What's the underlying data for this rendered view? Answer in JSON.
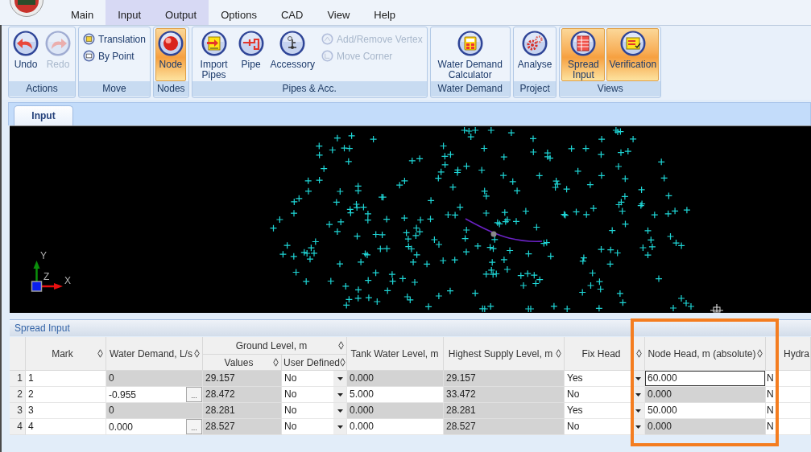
{
  "menu": {
    "tabs": [
      {
        "label": "Main",
        "contextual": false
      },
      {
        "label": "Input",
        "contextual": true
      },
      {
        "label": "Output",
        "contextual": true
      },
      {
        "label": "Options",
        "contextual": false
      },
      {
        "label": "CAD",
        "contextual": false
      },
      {
        "label": "View",
        "contextual": false
      },
      {
        "label": "Help",
        "contextual": false
      }
    ]
  },
  "ribbon": {
    "groups": [
      {
        "label": "Actions",
        "buttons": [
          {
            "kind": "large",
            "label": "Undo",
            "selected": false,
            "disabled": false
          },
          {
            "kind": "large",
            "label": "Redo",
            "selected": false,
            "disabled": true
          }
        ]
      },
      {
        "label": "Move",
        "buttons": [
          {
            "kind": "small",
            "label": "Translation",
            "selected": false,
            "disabled": false
          },
          {
            "kind": "small",
            "label": "By Point",
            "selected": false,
            "disabled": false
          }
        ]
      },
      {
        "label": "Nodes",
        "buttons": [
          {
            "kind": "large",
            "label": "Node",
            "selected": true,
            "disabled": false
          }
        ]
      },
      {
        "label": "Pipes & Acc.",
        "buttons": [
          {
            "kind": "large",
            "label": "Import Pipes",
            "selected": false,
            "disabled": false
          },
          {
            "kind": "large",
            "label": "Pipe",
            "selected": false,
            "disabled": false
          },
          {
            "kind": "large",
            "label": "Accessory",
            "selected": false,
            "disabled": false
          },
          {
            "kind": "small",
            "label": "Add/Remove Vertex",
            "selected": false,
            "disabled": true
          },
          {
            "kind": "small",
            "label": "Move Corner",
            "selected": false,
            "disabled": true
          }
        ]
      },
      {
        "label": "Water Demand",
        "buttons": [
          {
            "kind": "large",
            "label": "Water Demand Calculator",
            "selected": false,
            "disabled": false
          }
        ]
      },
      {
        "label": "Project",
        "buttons": [
          {
            "kind": "large",
            "label": "Analyse",
            "selected": false,
            "disabled": false
          }
        ]
      },
      {
        "label": "Views",
        "buttons": [
          {
            "kind": "large",
            "label": "Spread Input",
            "selected": true,
            "disabled": false
          },
          {
            "kind": "large",
            "label": "Verification",
            "selected": true,
            "disabled": false
          }
        ]
      }
    ]
  },
  "document_tabs": [
    {
      "label": "Input",
      "selected": true
    }
  ],
  "canvas": {
    "axes": {
      "x": "X",
      "y": "Y",
      "z": "Z"
    }
  },
  "spread_input": {
    "title": "Spread Input",
    "table": {
      "columns": [
        {
          "label": "Mark",
          "sortable": true,
          "highlighted": false
        },
        {
          "label": "Water Demand, L/s",
          "sortable": true,
          "highlighted": false
        },
        {
          "label": "Values",
          "sortable": true,
          "highlighted": false,
          "group": {
            "label": "Ground Level, m",
            "sortable": true,
            "highlighted": false
          }
        },
        {
          "label": "User Defined",
          "sortable": true,
          "highlighted": false,
          "joins_group": true
        },
        {
          "label": "Tank Water Level, m",
          "sortable": false,
          "highlighted": false
        },
        {
          "label": "Highest Supply Level, m",
          "sortable": true,
          "highlighted": false
        },
        {
          "label": "Fix Head",
          "sortable": true,
          "highlighted": false
        },
        {
          "label": "Node Head, m (absolute)",
          "sortable": true,
          "highlighted": true
        },
        {
          "label": "Hydra",
          "sortable": false,
          "highlighted": false
        }
      ],
      "rows": [
        {
          "number": "1",
          "cells": [
            {
              "kind": "text",
              "text": "1",
              "readonly": false,
              "selected": false
            },
            {
              "kind": "text",
              "text": "0",
              "readonly": true,
              "selected": false
            },
            {
              "kind": "text",
              "text": "29.157",
              "readonly": true,
              "selected": false
            },
            {
              "kind": "dropdown",
              "text": "No",
              "readonly": false,
              "selected": false
            },
            {
              "kind": "text",
              "text": "0.000",
              "readonly": true,
              "selected": false
            },
            {
              "kind": "text",
              "text": "29.157",
              "readonly": true,
              "selected": false
            },
            {
              "kind": "dropdown",
              "text": "Yes",
              "readonly": false,
              "selected": false
            },
            {
              "kind": "text",
              "text": "60.000",
              "readonly": false,
              "selected": true
            },
            {
              "kind": "text",
              "text": "N",
              "readonly": false,
              "selected": false
            }
          ]
        },
        {
          "number": "2",
          "cells": [
            {
              "kind": "text",
              "text": "2",
              "readonly": false,
              "selected": false
            },
            {
              "kind": "picker",
              "text": "-0.955",
              "button": "...",
              "readonly": false,
              "selected": false
            },
            {
              "kind": "text",
              "text": "28.472",
              "readonly": true,
              "selected": false
            },
            {
              "kind": "dropdown",
              "text": "No",
              "readonly": false,
              "selected": false
            },
            {
              "kind": "text",
              "text": "5.000",
              "readonly": false,
              "selected": false
            },
            {
              "kind": "text",
              "text": "33.472",
              "readonly": true,
              "selected": false
            },
            {
              "kind": "dropdown",
              "text": "No",
              "readonly": false,
              "selected": false
            },
            {
              "kind": "text",
              "text": "0.000",
              "readonly": true,
              "selected": false
            },
            {
              "kind": "text",
              "text": "N",
              "readonly": false,
              "selected": false
            }
          ]
        },
        {
          "number": "3",
          "cells": [
            {
              "kind": "text",
              "text": "3",
              "readonly": false,
              "selected": false
            },
            {
              "kind": "text",
              "text": "0",
              "readonly": true,
              "selected": false
            },
            {
              "kind": "text",
              "text": "28.281",
              "readonly": true,
              "selected": false
            },
            {
              "kind": "dropdown",
              "text": "No",
              "readonly": false,
              "selected": false
            },
            {
              "kind": "text",
              "text": "0.000",
              "readonly": true,
              "selected": false
            },
            {
              "kind": "text",
              "text": "28.281",
              "readonly": true,
              "selected": false
            },
            {
              "kind": "dropdown",
              "text": "Yes",
              "readonly": false,
              "selected": false
            },
            {
              "kind": "text",
              "text": "50.000",
              "readonly": false,
              "selected": false
            },
            {
              "kind": "text",
              "text": "N",
              "readonly": false,
              "selected": false
            }
          ]
        },
        {
          "number": "4",
          "cells": [
            {
              "kind": "text",
              "text": "4",
              "readonly": false,
              "selected": false
            },
            {
              "kind": "picker",
              "text": "0.000",
              "button": "...",
              "readonly": false,
              "selected": false
            },
            {
              "kind": "text",
              "text": "28.527",
              "readonly": true,
              "selected": false
            },
            {
              "kind": "dropdown",
              "text": "No",
              "readonly": false,
              "selected": false
            },
            {
              "kind": "text",
              "text": "0.000",
              "readonly": false,
              "selected": false
            },
            {
              "kind": "text",
              "text": "28.527",
              "readonly": true,
              "selected": false
            },
            {
              "kind": "dropdown",
              "text": "No",
              "readonly": false,
              "selected": false
            },
            {
              "kind": "text",
              "text": "0.000",
              "readonly": true,
              "selected": false
            },
            {
              "kind": "text",
              "text": "N",
              "readonly": false,
              "selected": false
            }
          ]
        }
      ]
    }
  }
}
